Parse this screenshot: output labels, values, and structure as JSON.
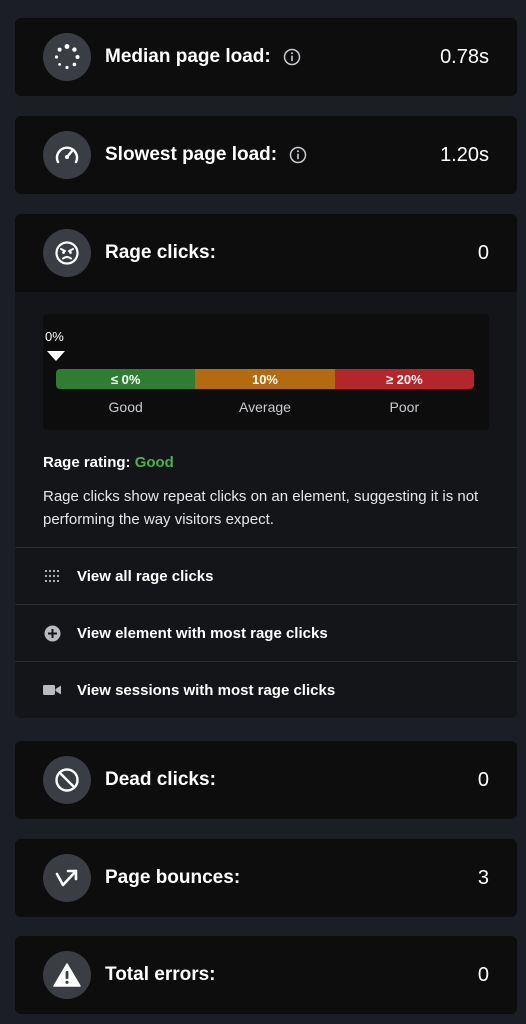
{
  "metrics": {
    "median": {
      "label": "Median page load:",
      "value": "0.78s",
      "icon": "loading-dots-icon"
    },
    "slowest": {
      "label": "Slowest page load:",
      "value": "1.20s",
      "icon": "speedometer-icon"
    },
    "rage": {
      "label": "Rage clicks:",
      "value": "0",
      "icon": "angry-face-icon"
    },
    "dead": {
      "label": "Dead clicks:",
      "value": "0",
      "icon": "prohibited-icon"
    },
    "bounces": {
      "label": "Page bounces:",
      "value": "3",
      "icon": "bounce-arrow-icon"
    },
    "errors": {
      "label": "Total errors:",
      "value": "0",
      "icon": "warning-triangle-icon"
    }
  },
  "rage_scale": {
    "marker": "0%",
    "marker_fraction": 0.0,
    "segments": [
      {
        "value": "≤ 0%",
        "label": "Good",
        "color": "#2e7d32"
      },
      {
        "value": "10%",
        "label": "Average",
        "color": "#b36b12"
      },
      {
        "value": "≥ 20%",
        "label": "Poor",
        "color": "#b3262b"
      }
    ]
  },
  "rage_rating": {
    "label": "Rage rating:",
    "value": "Good",
    "color": "#4caf50"
  },
  "rage_description": "Rage clicks show repeat clicks on an element, suggesting it is not performing the way visitors expect.",
  "actions": [
    {
      "label": "View all rage clicks",
      "icon": "dot-grid-icon"
    },
    {
      "label": "View element with most rage clicks",
      "icon": "plus-circle-icon"
    },
    {
      "label": "View sessions with most rage clicks",
      "icon": "video-camera-icon"
    }
  ]
}
